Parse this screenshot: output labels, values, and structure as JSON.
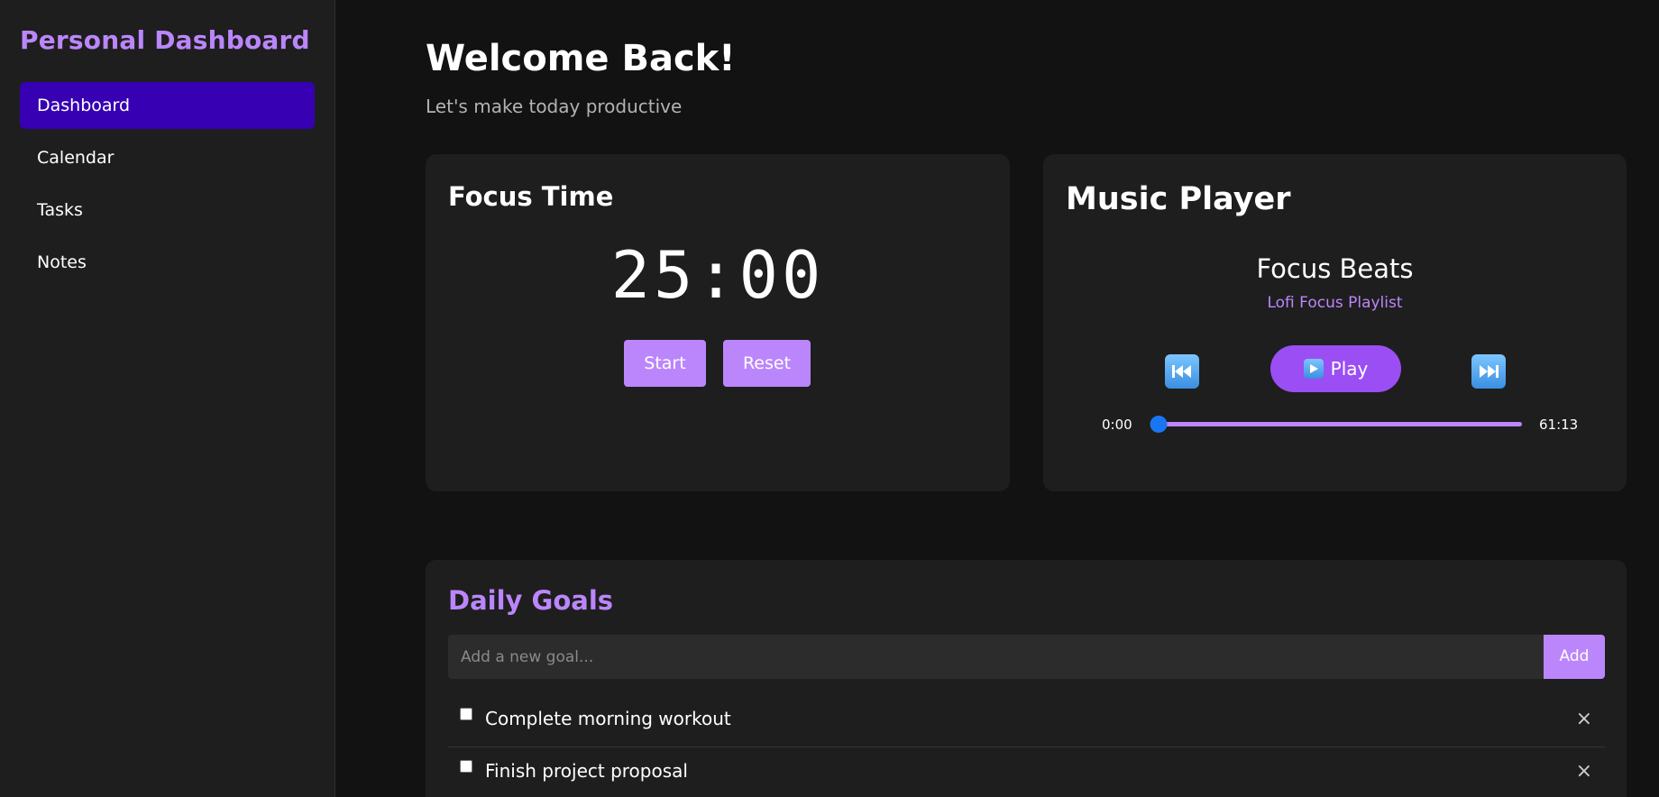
{
  "sidebar": {
    "brand": "Personal Dashboard",
    "items": [
      {
        "label": "Dashboard",
        "active": true
      },
      {
        "label": "Calendar",
        "active": false
      },
      {
        "label": "Tasks",
        "active": false
      },
      {
        "label": "Notes",
        "active": false
      }
    ]
  },
  "header": {
    "title": "Welcome Back!",
    "subtitle": "Let's make today productive"
  },
  "focus": {
    "title": "Focus Time",
    "timer": "25:00",
    "start_label": "Start",
    "reset_label": "Reset"
  },
  "music": {
    "title": "Music Player",
    "track": "Focus Beats",
    "playlist": "Lofi Focus Playlist",
    "prev_icon": "previous-track-icon",
    "next_icon": "next-track-icon",
    "play_icon": "play-icon",
    "play_label": "Play",
    "current_time": "0:00",
    "total_time": "61:13",
    "progress": 0
  },
  "goals": {
    "title": "Daily Goals",
    "placeholder": "Add a new goal...",
    "add_label": "Add",
    "delete_label": "×",
    "items": [
      {
        "text": "Complete morning workout",
        "done": false
      },
      {
        "text": "Finish project proposal",
        "done": false
      }
    ]
  },
  "colors": {
    "accent": "#bb86fc",
    "active_nav": "#3700b3",
    "play_button": "#9b4ef3",
    "background": "#121212",
    "card": "#1e1e1e"
  }
}
